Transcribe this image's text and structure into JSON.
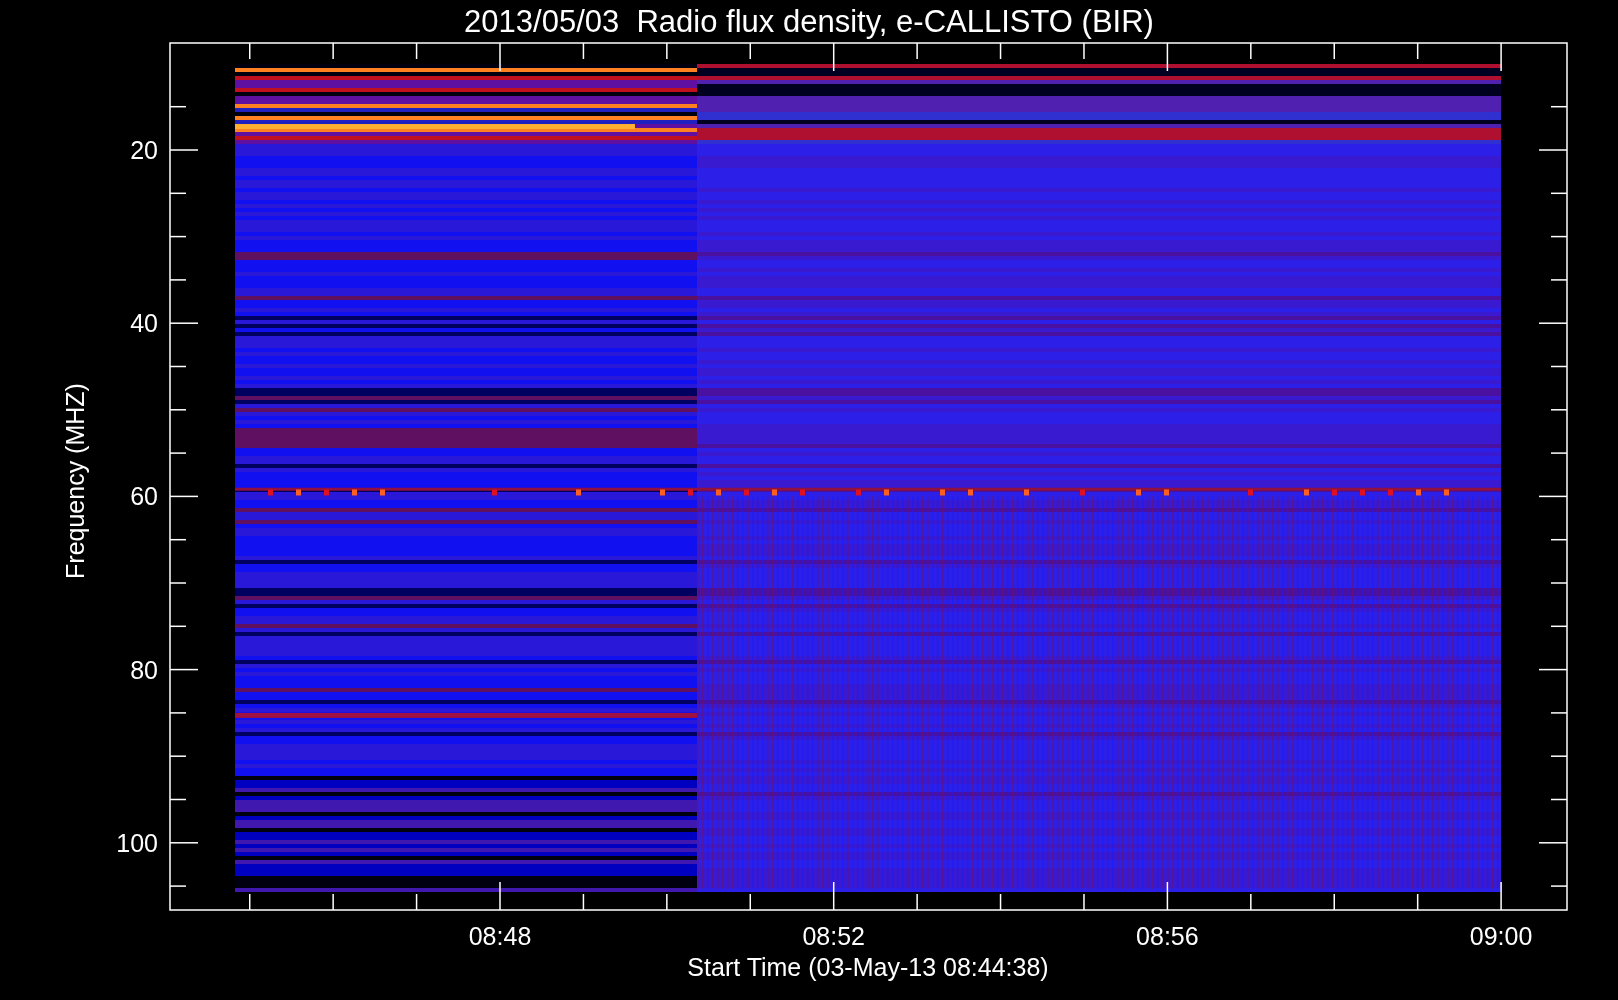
{
  "title": "2013/05/03  Radio flux density, e-CALLISTO (BIR)",
  "ylabel": "Frequency (MHZ)",
  "xlabel": "Start Time (03-May-13 08:44:38)",
  "yticks": [
    "20",
    "40",
    "60",
    "80",
    "100"
  ],
  "xticks": [
    "08:48",
    "08:52",
    "08:56",
    "09:00"
  ]
}
